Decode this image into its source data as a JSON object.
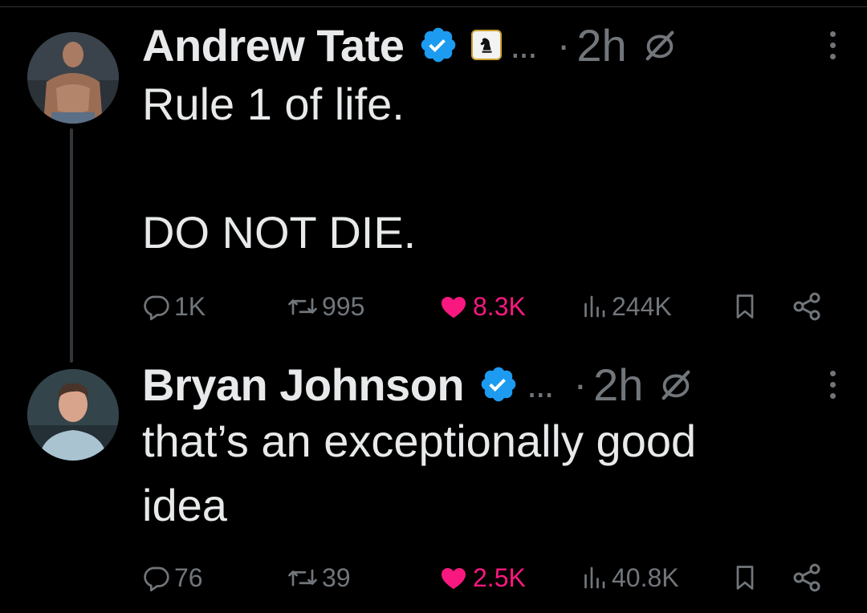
{
  "colors": {
    "background": "#000000",
    "text_primary": "#e7e9ea",
    "text_secondary": "#71767b",
    "verified_blue": "#1d9bf0",
    "like_pink": "#f91880"
  },
  "tweets": [
    {
      "author_name": "Andrew Tate",
      "verified_icon": "verified-badge-icon",
      "affiliate_icon": "chess-knight-icon",
      "truncation": "...",
      "separator": "·",
      "time": "2h",
      "text": "Rule 1 of life.\n\nDO NOT DIE.",
      "stats": {
        "replies": "1K",
        "retweets": "995",
        "likes": "8.3K",
        "views": "244K"
      },
      "liked": true
    },
    {
      "author_name": "Bryan Johnson",
      "verified_icon": "verified-badge-icon",
      "truncation": "...",
      "separator": "·",
      "time": "2h",
      "text": "that’s an exceptionally good\nidea",
      "stats": {
        "replies": "76",
        "retweets": "39",
        "likes": "2.5K",
        "views": "40.8K"
      },
      "liked": true
    }
  ]
}
